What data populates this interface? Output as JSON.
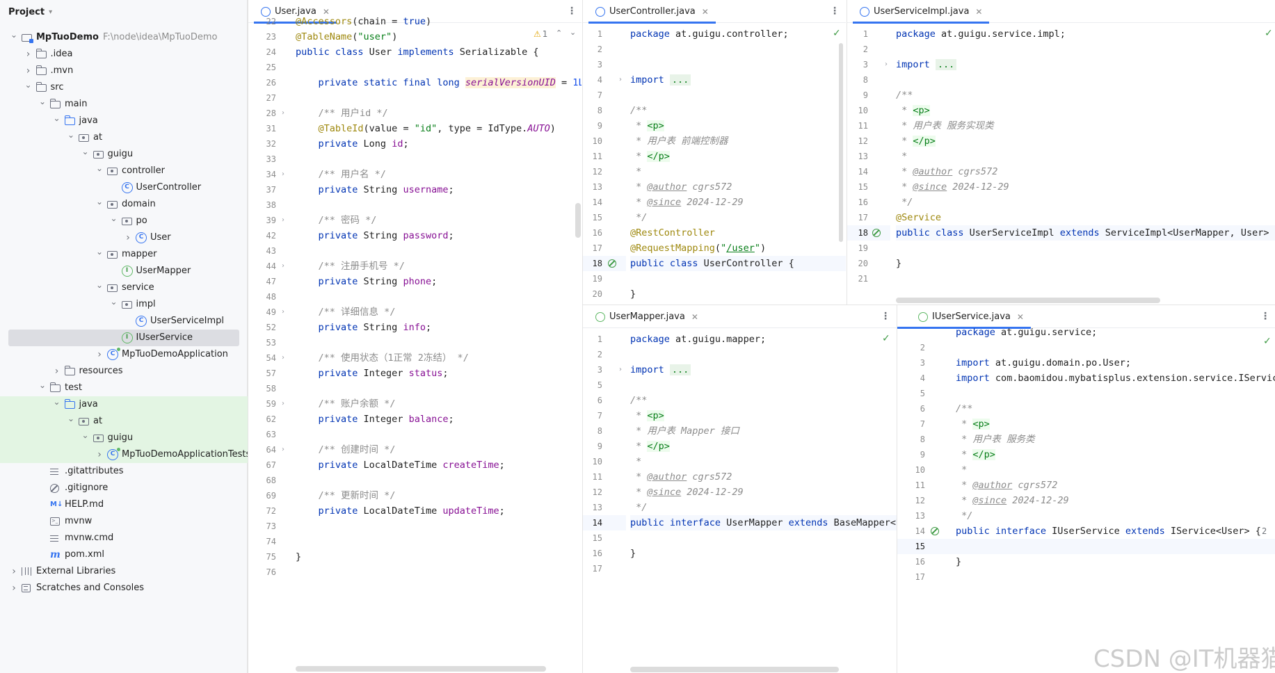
{
  "project": {
    "title": "Project",
    "tree": [
      {
        "label": "MpTuoDemo",
        "path": "F:\\node\\idea\\MpTuoDemo",
        "bold": true
      },
      {
        "label": ".idea"
      },
      {
        "label": ".mvn"
      },
      {
        "label": "src"
      },
      {
        "label": "main"
      },
      {
        "label": "java"
      },
      {
        "label": "at"
      },
      {
        "label": "guigu"
      },
      {
        "label": "controller"
      },
      {
        "label": "UserController"
      },
      {
        "label": "domain"
      },
      {
        "label": "po"
      },
      {
        "label": "User"
      },
      {
        "label": "mapper"
      },
      {
        "label": "UserMapper"
      },
      {
        "label": "service"
      },
      {
        "label": "impl"
      },
      {
        "label": "UserServiceImpl"
      },
      {
        "label": "IUserService"
      },
      {
        "label": "MpTuoDemoApplication"
      },
      {
        "label": "resources"
      },
      {
        "label": "test"
      },
      {
        "label": "java"
      },
      {
        "label": "at"
      },
      {
        "label": "guigu"
      },
      {
        "label": "MpTuoDemoApplicationTests"
      },
      {
        "label": ".gitattributes"
      },
      {
        "label": ".gitignore"
      },
      {
        "label": "HELP.md"
      },
      {
        "label": "mvnw"
      },
      {
        "label": "mvnw.cmd"
      },
      {
        "label": "pom.xml"
      },
      {
        "label": "External Libraries"
      },
      {
        "label": "Scratches and Consoles"
      }
    ]
  },
  "icons": {
    "folder": "folder-icon",
    "package": "package-icon",
    "class": "class-icon",
    "interface": "interface-icon",
    "app": "spring-boot-app-icon",
    "check": "check-icon",
    "warning": "warning-icon"
  },
  "colors": {
    "keyword": "#0033b3",
    "string": "#067d17",
    "annotation": "#9e880d",
    "comment": "#8c8c8c",
    "field": "#871094",
    "accent": "#3574f0"
  },
  "editors": {
    "user": {
      "tab": "User.java",
      "warning_count": "1",
      "line_numbers": [
        "22",
        "23",
        "24",
        "25",
        "26",
        "27",
        "28",
        "31",
        "32",
        "33",
        "34",
        "37",
        "38",
        "39",
        "42",
        "43",
        "44",
        "47",
        "48",
        "49",
        "52",
        "53",
        "54",
        "57",
        "58",
        "59",
        "62",
        "63",
        "64",
        "67",
        "68",
        "69",
        "72",
        "73",
        "74",
        "75",
        "76"
      ],
      "lines": {
        "l22a": "@Accessors",
        "l22b": "(chain = ",
        "l22c": "true",
        "l22d": ")",
        "l23a": "@TableName",
        "l23b": "(",
        "l23c": "\"user\"",
        "l23d": ")",
        "l24a": "public class ",
        "l24b": "User ",
        "l24c": "implements ",
        "l24d": "Serializable {",
        "l26a": "    private static final long ",
        "l26b": "serialVersionUID",
        "l26c": " = ",
        "l26d": "1L",
        "l26e": ";",
        "l28": "    /** 用户id */",
        "l31a": "    @TableId",
        "l31b": "(value = ",
        "l31c": "\"id\"",
        "l31d": ", type = IdType.",
        "l31e": "AUTO",
        "l31f": ")",
        "l32a": "    private ",
        "l32b": "Long ",
        "l32c": "id",
        "l32d": ";",
        "l34": "    /** 用户名 */",
        "l37a": "    private ",
        "l37b": "String ",
        "l37c": "username",
        "l37d": ";",
        "l39": "    /** 密码 */",
        "l42a": "    private ",
        "l42b": "String ",
        "l42c": "password",
        "l42d": ";",
        "l44": "    /** 注册手机号 */",
        "l47a": "    private ",
        "l47b": "String ",
        "l47c": "phone",
        "l47d": ";",
        "l49": "    /** 详细信息 */",
        "l52a": "    private ",
        "l52b": "String ",
        "l52c": "info",
        "l52d": ";",
        "l54": "    /** 使用状态（1正常 2冻结） */",
        "l57a": "    private ",
        "l57b": "Integer ",
        "l57c": "status",
        "l57d": ";",
        "l59": "    /** 账户余额 */",
        "l62a": "    private ",
        "l62b": "Integer ",
        "l62c": "balance",
        "l62d": ";",
        "l64": "    /** 创建时间 */",
        "l67a": "    private ",
        "l67b": "LocalDateTime ",
        "l67c": "createTime",
        "l67d": ";",
        "l69": "    /** 更新时间 */",
        "l72a": "    private ",
        "l72b": "LocalDateTime ",
        "l72c": "updateTime",
        "l72d": ";",
        "l75": "}"
      }
    },
    "controller": {
      "tab": "UserController.java",
      "line_numbers": [
        "1",
        "2",
        "3",
        "4",
        "7",
        "8",
        "9",
        "10",
        "11",
        "12",
        "13",
        "14",
        "15",
        "16",
        "17",
        "18",
        "19",
        "20"
      ],
      "lines": {
        "l1a": "package ",
        "l1b": "at.guigu.controller;",
        "l4a": "import ",
        "l4b": "...",
        "l8": "/**",
        "l9a": " * ",
        "l9b": "<p>",
        "l10": " * 用户表 前端控制器",
        "l11a": " * ",
        "l11b": "</p>",
        "l12": " *",
        "l13a": " * ",
        "l13b": "@author",
        "l13c": " cgrs572",
        "l14a": " * ",
        "l14b": "@since",
        "l14c": " 2024-12-29",
        "l15": " */",
        "l16": "@RestController",
        "l17a": "@RequestMapping",
        "l17b": "(",
        "l17c": "\"",
        "l17d": "/user",
        "l17e": "\"",
        "l17f": ")",
        "l18a": "public class ",
        "l18b": "UserController {",
        "l20": "}"
      }
    },
    "serviceimpl": {
      "tab": "UserServiceImpl.java",
      "line_numbers": [
        "1",
        "2",
        "3",
        "8",
        "9",
        "10",
        "11",
        "12",
        "13",
        "14",
        "15",
        "16",
        "17",
        "18",
        "19",
        "20",
        "21"
      ],
      "lines": {
        "l1a": "package ",
        "l1b": "at.guigu.service.impl;",
        "l3a": "import ",
        "l3b": "...",
        "l9": "/**",
        "l10a": " * ",
        "l10b": "<p>",
        "l11": " * 用户表 服务实现类",
        "l12a": " * ",
        "l12b": "</p>",
        "l13": " *",
        "l14a": " * ",
        "l14b": "@author",
        "l14c": " cgrs572",
        "l15a": " * ",
        "l15b": "@since",
        "l15c": " 2024-12-29",
        "l16": " */",
        "l17": "@Service",
        "l18a": "public class ",
        "l18b": "UserServiceImpl ",
        "l18c": "extends ",
        "l18d": "ServiceImpl<UserMapper, User> ",
        "l18e": "im",
        "l20": "}"
      }
    },
    "mapper": {
      "tab": "UserMapper.java",
      "line_numbers": [
        "1",
        "2",
        "3",
        "5",
        "6",
        "7",
        "8",
        "9",
        "10",
        "11",
        "12",
        "13",
        "14",
        "15",
        "16",
        "17"
      ],
      "lines": {
        "l1a": "package ",
        "l1b": "at.guigu.mapper;",
        "l3a": "import ",
        "l3b": "...",
        "l6": "/**",
        "l7a": " * ",
        "l7b": "<p>",
        "l8": " * 用户表 Mapper 接口",
        "l9a": " * ",
        "l9b": "</p>",
        "l10": " *",
        "l11a": " * ",
        "l11b": "@author",
        "l11c": " cgrs572",
        "l12a": " * ",
        "l12b": "@since",
        "l12c": " 2024-12-29",
        "l13": " */",
        "l14a": "public interface ",
        "l14b": "UserMapper ",
        "l14c": "extends ",
        "l14d": "BaseMapper<U",
        "l16": "}"
      }
    },
    "iuserservice": {
      "tab": "IUserService.java",
      "line_numbers": [
        "2",
        "3",
        "4",
        "5",
        "6",
        "7",
        "8",
        "9",
        "10",
        "11",
        "12",
        "13",
        "14",
        "15",
        "16",
        "17"
      ],
      "usage_count": "2",
      "lines": {
        "l1a": "package ",
        "l1b": "at.guigu.service;",
        "l3a": "import ",
        "l3b": "at.guigu.domain.po.User;",
        "l4a": "import ",
        "l4b": "com.baomidou.mybatisplus.extension.service.IServic",
        "l6": "/**",
        "l7a": " * ",
        "l7b": "<p>",
        "l8": " * 用户表 服务类",
        "l9a": " * ",
        "l9b": "</p>",
        "l10": " *",
        "l11a": " * ",
        "l11b": "@author",
        "l11c": " cgrs572",
        "l12a": " * ",
        "l12b": "@since",
        "l12c": " 2024-12-29",
        "l13": " */",
        "l14a": "public interface ",
        "l14b": "IUserService ",
        "l14c": "extends ",
        "l14d": "IService<User> {",
        "l16": "}"
      }
    }
  },
  "watermark": "CSDN @IT机器猫"
}
